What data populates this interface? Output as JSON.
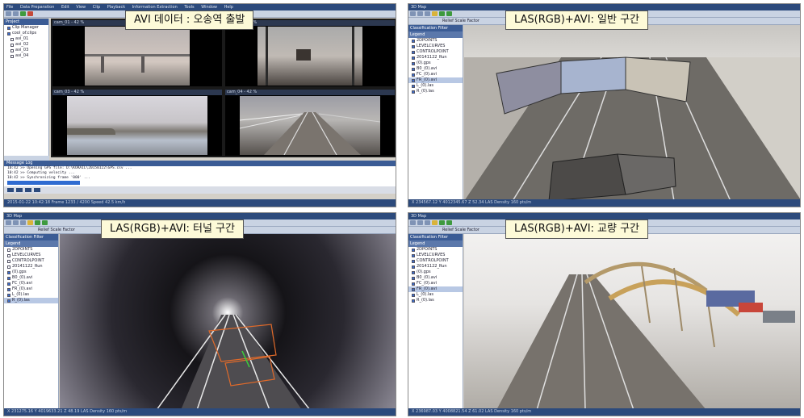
{
  "panels": [
    {
      "caption": "AVI 데이터 : 오송역 출발",
      "menu": [
        "File",
        "Data Preparation",
        "Edit",
        "View",
        "Clip",
        "Playback",
        "Information Extraction",
        "Tools",
        "Window",
        "Help"
      ],
      "project_panel_title": "Project",
      "tree_items": [
        "Clip Manager",
        "cool_of.clips",
        "avi_01",
        "avi_02",
        "avi_03",
        "avi_04"
      ],
      "video_labels": [
        "cam_01 - 42 %",
        "cam_02 - 42 %",
        "cam_03 - 42 %",
        "cam_04 - 42 %"
      ],
      "log_lines": [
        "10:42 >> Opening GPS file: D:\\KORAIL\\20150122\\GPS.csv ...",
        "10:42 >> Computing velocity ...",
        "10:42 >> Synchronizing frame '000' ..."
      ],
      "status": "2015-01-22  10:42:18  Frame 1233 / 4200  Speed 42.5 km/h"
    },
    {
      "caption": "LAS(RGB)+AVI: 일반 구간",
      "window_title": "3D Map",
      "filter_label": "Classification Filter",
      "legend_title": "Legend",
      "relief_label": "Relief Scale Factor",
      "legend_items": [
        "2DPOINTS",
        "LEVELCURVES",
        "CONTROLPOINT",
        "20141122_Run",
        "(0).gps",
        "B0_(0).avi",
        "FC_(0).avi",
        "FR_(0).avi",
        "L_(0).las",
        "R_(0).las"
      ],
      "status": "X 234567.12  Y 4012345.67  Z 52.34   LAS Density 160 pts/m"
    },
    {
      "caption": "LAS(RGB)+AVI: 터널 구간",
      "window_title": "3D Map",
      "filter_label": "Classification Filter",
      "legend_title": "Legend",
      "relief_label": "Relief Scale Factor",
      "legend_items": [
        "2DPOINTS",
        "LEVELCURVES",
        "CONTROLPOINT",
        "20141122_Run",
        "(0).gps",
        "B0_(0).avi",
        "FC_(0).avi",
        "FR_(0).avi",
        "L_(0).las",
        "R_(0).las"
      ],
      "status": "X 231275.16  Y 4019633.21  Z 48.19   LAS Density 160 pts/m"
    },
    {
      "caption": "LAS(RGB)+AVI: 교량 구간",
      "window_title": "3D Map",
      "filter_label": "Classification Filter",
      "legend_title": "Legend",
      "relief_label": "Relief Scale Factor",
      "legend_items": [
        "2DPOINTS",
        "LEVELCURVES",
        "CONTROLPOINT",
        "20141122_Run",
        "(0).gps",
        "B0_(0).avi",
        "FC_(0).avi",
        "FR_(0).avi",
        "L_(0).las",
        "R_(0).las"
      ],
      "status": "X 236987.03  Y 4008821.54  Z 61.02   LAS Density 160 pts/m"
    }
  ]
}
